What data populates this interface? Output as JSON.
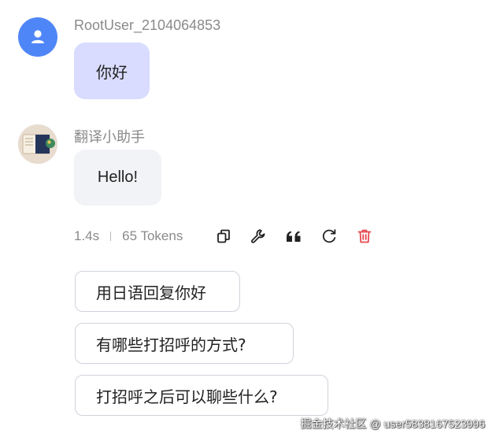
{
  "messages": {
    "user": {
      "name": "RootUser_2104064853",
      "text": "你好",
      "avatar_icon": "user-icon",
      "avatar_color": "#4f86f7",
      "bubble_color": "#d9dcff"
    },
    "bot": {
      "name": "翻译小助手",
      "text": "Hello!",
      "avatar_icon": "book-globe-icon",
      "bubble_color": "#f2f3f6"
    }
  },
  "meta": {
    "duration": "1.4s",
    "tokens": "65 Tokens"
  },
  "actions": [
    {
      "icon": "copy-icon"
    },
    {
      "icon": "wrench-icon"
    },
    {
      "icon": "quote-icon"
    },
    {
      "icon": "refresh-icon"
    },
    {
      "icon": "delete-icon",
      "color": "#e5484d"
    }
  ],
  "suggestions": [
    "用日语回复你好",
    "有哪些打招呼的方式?",
    "打招呼之后可以聊些什么?"
  ],
  "watermark": "掘金技术社区 @ user5838167523996"
}
